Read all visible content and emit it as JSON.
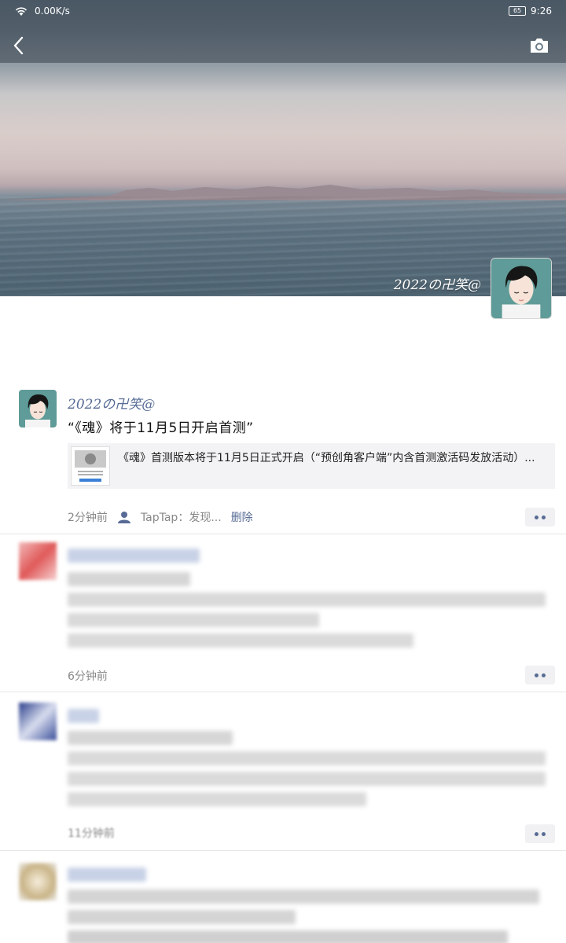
{
  "status_bar": {
    "speed": "0.00K/s",
    "battery": "65",
    "time": "9:26"
  },
  "icons": {
    "back": "chevron-left-icon",
    "camera": "camera-icon",
    "wifi": "wifi-icon",
    "more": "more-dots-icon",
    "source": "person-icon"
  },
  "cover": {
    "name": "2022の卍笑@"
  },
  "post": {
    "author": "2022の卍笑@",
    "text": "“《魂》将于11月5日开启首测”",
    "link_text": "《魂》首测版本将于11月5日正式开启（“预创角客户端”内含首测激活码发放活动）...",
    "time": "2分钟前",
    "source": "TapTap：发现...",
    "delete": "删除"
  },
  "feed": [
    {
      "time": "6分钟前"
    },
    {
      "time": "11分钟前"
    }
  ],
  "colors": {
    "link_blue": "#576b95",
    "meta_gray": "#888888"
  }
}
